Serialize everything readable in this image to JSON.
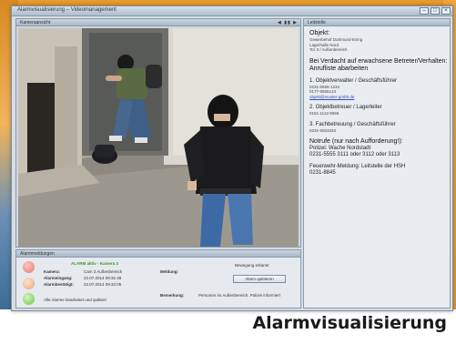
{
  "window": {
    "title": "Alarmvisualisierung – Videomanagement",
    "controls": {
      "minimize": "–",
      "maximize": "□",
      "close": "×"
    }
  },
  "video": {
    "panel_title": "Kameraansicht",
    "controls": "◀ ▮▮ ▶"
  },
  "info": {
    "header": "Leitstelle",
    "object_label": "Objekt:",
    "object_lines": [
      "Gewerbehof Dortmund-Eving",
      "Lagerhalle Nord",
      "Tor 3 / Außenbereich"
    ],
    "instruction": "Bei Verdacht auf erwachsene Betreter/Verhalten:",
    "instruction2": "Anrufliste abarbeiten",
    "contact1_title": "1. Objektverwalter / Geschäftsführer",
    "contact1_lines": [
      "0231-5555-1234",
      "0177-5555123"
    ],
    "contact1_email": "objekt@muster-gmbh.de",
    "contact2_title": "2. Objektbetreuer / Lagerleiter",
    "contact2_lines": [
      "0151-1112-5555"
    ],
    "contact3_title": "3. Fachbetreuung / Geschäftsführer",
    "contact3_lines": [
      "0231-5553333"
    ],
    "notruf_title": "Notrufe (nur nach Aufforderung!):",
    "notruf_lines": [
      "Polizei: Wache Nordstadt",
      "0231-5555 3111 oder 3112 oder 3113"
    ],
    "feuerwehr_title": "Feuerwehr-Meldung: Leitstelle der HSH",
    "feuerwehr_lines": [
      "0231-8845"
    ]
  },
  "alarm": {
    "panel_title": "Alarmmeldungen",
    "status_text": "ALARM aktiv - Kamera 3",
    "rows": [
      {
        "label": "Kamera:",
        "value": "Cam 3 Außenbereich"
      },
      {
        "label": "Alarmeingang:",
        "value": "22.07.2014 09:31:48"
      },
      {
        "label": "Alarmbestätigt:",
        "value": "22.07.2014 09:32:05"
      }
    ],
    "footer_text": "Alle Alarme bearbeitet und quittiert",
    "meldung_label": "Meldung:",
    "meldung_value": "Bewegung erkannt",
    "bemerkung_label": "Bemerkung:",
    "bemerkung_value": "Personen im Außenbereich, Polizei informiert",
    "action_button": "Alarm quittieren"
  },
  "caption": "Alarmvisualisierung",
  "colors": {
    "frame": "#e89a2a",
    "window": "#d6dde4",
    "alarm_red": "#e4776c",
    "alarm_green": "#6dc24a",
    "link": "#2c4fb8"
  }
}
